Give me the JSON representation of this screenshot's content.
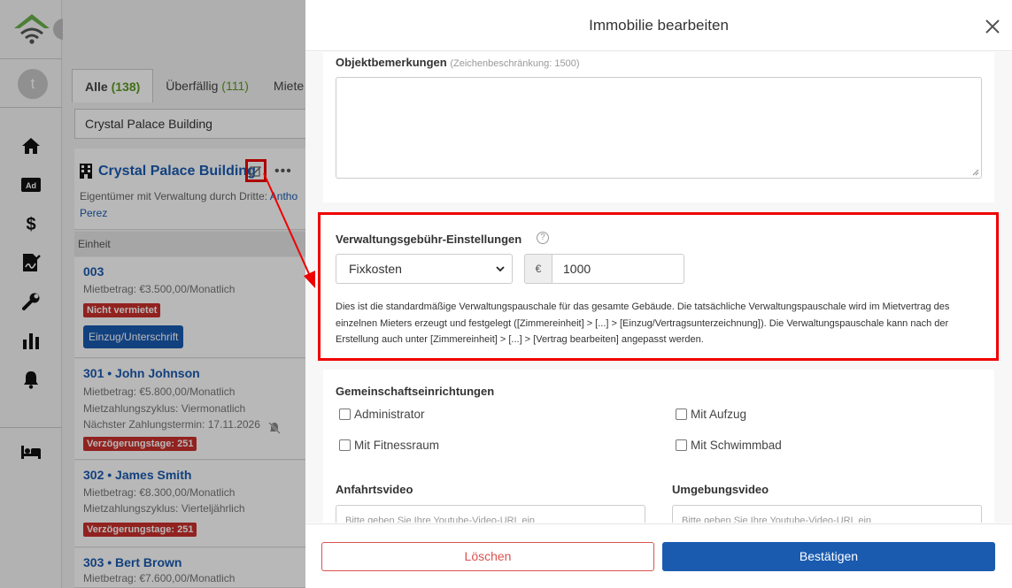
{
  "colors": {
    "accent": "#1a5bb0",
    "annotation": "#e00000",
    "danger": "#c9302c",
    "count_green": "#5c9a1f"
  },
  "sidebar": {
    "avatar_letter": "t",
    "icons": [
      "home-icon",
      "ad-icon",
      "dollar-icon",
      "signature-icon",
      "wrench-icon",
      "bar-chart-icon",
      "bell-icon",
      "bed-icon"
    ]
  },
  "list": {
    "tabs": [
      {
        "label": "Alle",
        "count": "(138)"
      },
      {
        "label": "Überfällig",
        "count": "(111)"
      },
      {
        "label": "Miete"
      }
    ],
    "search_value": "Crystal Palace Building",
    "building": {
      "name": "Crystal Palace Building",
      "owner_prefix": "Eigentümer mit Verwaltung durch Dritte:",
      "owner_name_1": "Antho",
      "owner_name_2": "Perez"
    },
    "column_header": "Einheit",
    "units": [
      {
        "name": "003",
        "line1": "Mietbetrag: €3.500,00/Monatlich",
        "badge": "Nicht vermietet",
        "button": "Einzug/Unterschrift"
      },
      {
        "name": "301 • John Johnson",
        "line1": "Mietbetrag: €5.800,00/Monatlich",
        "line2": "Mietzahlungszyklus: Viermonatlich",
        "line3": "Nächster Zahlungstermin:  17.11.2026",
        "badge": "Verzögerungstage: 251"
      },
      {
        "name": "302 • James Smith",
        "line1": "Mietbetrag: €8.300,00/Monatlich",
        "line2": "Mietzahlungszyklus: Vierteljährlich",
        "badge": "Verzögerungstage: 251"
      },
      {
        "name": "303 • Bert Brown",
        "line1": "Mietbetrag: €7.600,00/Monatlich"
      }
    ]
  },
  "modal": {
    "title": "Immobilie bearbeiten",
    "remarks": {
      "label": "Objektbemerkungen",
      "hint": "(Zeichenbeschränkung: 1500)"
    },
    "fee": {
      "label": "Verwaltungsgebühr-Einstellungen",
      "help": "?",
      "type_selected": "Fixkosten",
      "currency": "€",
      "amount": "1000",
      "description": "Dies ist die standardmäßige Verwaltungspauschale für das gesamte Gebäude. Die tatsächliche Verwaltungspauschale wird im Mietvertrag des einzelnen Mieters erzeugt und festgelegt ([Zimmereinheit] > [...] > [Einzug/Vertragsunterzeichnung]). Die Verwaltungspauschale kann nach der Erstellung auch unter [Zimmereinheit] > [...] > [Vertrag bearbeiten] angepasst werden."
    },
    "amenities": {
      "label": "Gemeinschaftseinrichtungen",
      "items": [
        "Administrator",
        "Mit Aufzug",
        "Mit Fitnessraum",
        "Mit Schwimmbad"
      ]
    },
    "video_approach": {
      "label": "Anfahrtsvideo",
      "placeholder": "Bitte geben Sie Ihre Youtube-Video-URL ein"
    },
    "video_area": {
      "label": "Umgebungsvideo",
      "placeholder": "Bitte geben Sie Ihre Youtube-Video-URL ein"
    },
    "delete_label": "Löschen",
    "confirm_label": "Bestätigen"
  }
}
